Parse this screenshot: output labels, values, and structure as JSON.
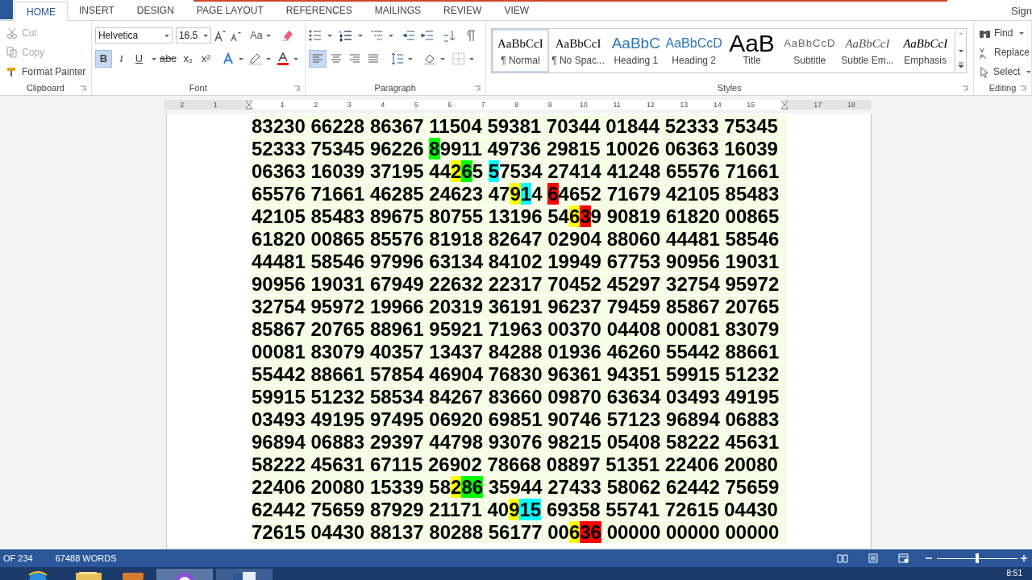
{
  "tabs": [
    {
      "label": "HOME",
      "selected": true
    },
    {
      "label": "INSERT",
      "selected": false
    },
    {
      "label": "DESIGN",
      "selected": false
    },
    {
      "label": "PAGE LAYOUT",
      "selected": false
    },
    {
      "label": "REFERENCES",
      "selected": false
    },
    {
      "label": "MAILINGS",
      "selected": false
    },
    {
      "label": "REVIEW",
      "selected": false
    },
    {
      "label": "VIEW",
      "selected": false
    }
  ],
  "account": "Sign",
  "clipboard": {
    "title": "Clipboard",
    "items": [
      {
        "kind": "cut",
        "label": "Cut",
        "disabled": true
      },
      {
        "kind": "copy",
        "label": "Copy",
        "disabled": true
      },
      {
        "kind": "painter",
        "label": "Format Painter",
        "disabled": false
      }
    ]
  },
  "font": {
    "title": "Font",
    "name": "Helvetica",
    "size": "16.5",
    "case_label": "Aa",
    "format": [
      {
        "kind": "bold",
        "label": "B",
        "selected": true
      },
      {
        "kind": "italic",
        "label": "I",
        "selected": false
      },
      {
        "kind": "underline",
        "label": "U",
        "selected": false
      },
      {
        "kind": "strike",
        "label": "abc",
        "selected": false
      },
      {
        "kind": "sub",
        "label": "x₂",
        "selected": false
      },
      {
        "kind": "sup",
        "label": "x²",
        "selected": false
      }
    ]
  },
  "paragraph": {
    "title": "Paragraph",
    "align": [
      {
        "kind": "left",
        "selected": true
      },
      {
        "kind": "center",
        "selected": false
      },
      {
        "kind": "right",
        "selected": false
      },
      {
        "kind": "justify",
        "selected": false
      }
    ]
  },
  "styles": {
    "title": "Styles",
    "items": [
      {
        "kind": "normal",
        "preview": "AaBbCcI",
        "label": "¶ Normal",
        "selected": true
      },
      {
        "kind": "nospacing",
        "preview": "AaBbCcI",
        "label": "¶ No Spac...",
        "selected": false
      },
      {
        "kind": "heading1",
        "preview": "AaBbC",
        "label": "Heading 1",
        "selected": false
      },
      {
        "kind": "heading2",
        "preview": "AaBbCcD",
        "label": "Heading 2",
        "selected": false
      },
      {
        "kind": "title",
        "preview": "AaB",
        "label": "Title",
        "selected": false
      },
      {
        "kind": "subtitle",
        "preview": "AaBbCcD",
        "label": "Subtitle",
        "selected": false
      },
      {
        "kind": "subtle",
        "preview": "AaBbCcI",
        "label": "Subtle Em...",
        "selected": false
      },
      {
        "kind": "emphasis",
        "preview": "AaBbCcI",
        "label": "Emphasis",
        "selected": false
      }
    ]
  },
  "editing": {
    "title": "Editing",
    "items": [
      {
        "kind": "find",
        "label": "Find"
      },
      {
        "kind": "replace",
        "label": "Replace"
      },
      {
        "kind": "select",
        "label": "Select"
      }
    ]
  },
  "ruler": [
    {
      "label": "2"
    },
    {
      "label": "1"
    },
    {
      "kind": "indent"
    },
    {
      "label": "1"
    },
    {
      "label": "2"
    },
    {
      "label": "3"
    },
    {
      "label": "4"
    },
    {
      "label": "5"
    },
    {
      "label": "6"
    },
    {
      "label": "7"
    },
    {
      "label": "8"
    },
    {
      "label": "9"
    },
    {
      "label": "10"
    },
    {
      "label": "11"
    },
    {
      "label": "12"
    },
    {
      "label": "13"
    },
    {
      "label": "14"
    },
    {
      "label": "15"
    },
    {
      "kind": "indent"
    },
    {
      "label": "17"
    },
    {
      "label": "18"
    }
  ],
  "document": {
    "lines": [
      [
        "83230",
        "66228",
        "86367",
        "11504",
        "59381",
        "70344",
        "01844",
        "52333",
        "75345"
      ],
      [
        "52333",
        "75345",
        "96226",
        {
          "parts": [
            {
              "text": "8",
              "color": "#00ff00"
            },
            {
              "text": "9911"
            }
          ]
        },
        "49736",
        "29815",
        "10026",
        "06363",
        "16039"
      ],
      [
        "06363",
        "16039",
        "37195",
        {
          "parts": [
            {
              "text": "44"
            },
            {
              "text": "2",
              "color": "#ffff00"
            },
            {
              "text": "6",
              "color": "#00ff00"
            },
            {
              "text": "5"
            }
          ]
        },
        {
          "parts": [
            {
              "text": "5",
              "color": "#00ffff"
            },
            {
              "text": "7534"
            }
          ]
        },
        "27414",
        "41248",
        "65576",
        "71661"
      ],
      [
        "65576",
        "71661",
        "46285",
        "24623",
        {
          "parts": [
            {
              "text": "47"
            },
            {
              "text": "9",
              "color": "#ffff00"
            },
            {
              "text": "1",
              "color": "#00ffff"
            },
            {
              "text": "4"
            }
          ]
        },
        {
          "parts": [
            {
              "text": "6",
              "color": "#ff0000"
            },
            {
              "text": "4652"
            }
          ]
        },
        "71679",
        "42105",
        "85483"
      ],
      [
        "42105",
        "85483",
        "89675",
        "80755",
        "13196",
        {
          "parts": [
            {
              "text": "54"
            },
            {
              "text": "6",
              "color": "#ffff00"
            },
            {
              "text": "3",
              "color": "#ff0000"
            },
            {
              "text": "9"
            }
          ]
        },
        "90819",
        "61820",
        "00865"
      ],
      [
        "61820",
        "00865",
        "85576",
        "81918",
        "82647",
        "02904",
        "88060",
        "44481",
        "58546"
      ],
      [
        "44481",
        "58546",
        "97996",
        "63134",
        "84102",
        "19949",
        "67753",
        "90956",
        "19031"
      ],
      [
        "90956",
        "19031",
        "67949",
        "22632",
        "22317",
        "70452",
        "45297",
        "32754",
        "95972"
      ],
      [
        "32754",
        "95972",
        "19966",
        "20319",
        "36191",
        "96237",
        "79459",
        "85867",
        "20765"
      ],
      [
        "85867",
        "20765",
        "88961",
        "95921",
        "71963",
        "00370",
        "04408",
        "00081",
        "83079"
      ],
      [
        "00081",
        "83079",
        "40357",
        "13437",
        "84288",
        "01936",
        "46260",
        "55442",
        "88661"
      ],
      [
        "55442",
        "88661",
        "57854",
        "46904",
        "76830",
        "96361",
        "94351",
        "59915",
        "51232"
      ],
      [
        "59915",
        "51232",
        "58534",
        "84267",
        "83660",
        "09870",
        "63634",
        "03493",
        "49195"
      ],
      [
        "03493",
        "49195",
        "97495",
        "06920",
        "69851",
        "90746",
        "57123",
        "96894",
        "06883"
      ],
      [
        "96894",
        "06883",
        "29397",
        "44798",
        "93076",
        "98215",
        "05408",
        "58222",
        "45631"
      ],
      [
        "58222",
        "45631",
        "67115",
        "26902",
        "78668",
        "08897",
        "51351",
        "22406",
        "20080"
      ],
      [
        "22406",
        "20080",
        "15339",
        {
          "parts": [
            {
              "text": "58"
            },
            {
              "text": "2",
              "color": "#ffff00"
            },
            {
              "text": "86",
              "color": "#00ff00"
            }
          ]
        },
        "35944",
        "27433",
        "58062",
        "62442",
        "75659"
      ],
      [
        "62442",
        "75659",
        "87929",
        "21171",
        {
          "parts": [
            {
              "text": "40"
            },
            {
              "text": "9",
              "color": "#ffff00"
            },
            {
              "text": "15",
              "color": "#00ffff"
            }
          ]
        },
        "69358",
        "55741",
        "72615",
        "04430"
      ],
      [
        "72615",
        "04430",
        "88137",
        "80288",
        "56177",
        {
          "parts": [
            {
              "text": "00"
            },
            {
              "text": "6",
              "color": "#ffff00"
            },
            {
              "text": "36",
              "color": "#ff0000"
            }
          ]
        },
        "00000",
        "00000",
        "00000"
      ]
    ]
  },
  "status_bar": {
    "page": "OF 234",
    "words": "67488 WORDS",
    "zoom": {
      "level": 0.5
    }
  },
  "taskbar": {
    "clock": "8:51"
  }
}
